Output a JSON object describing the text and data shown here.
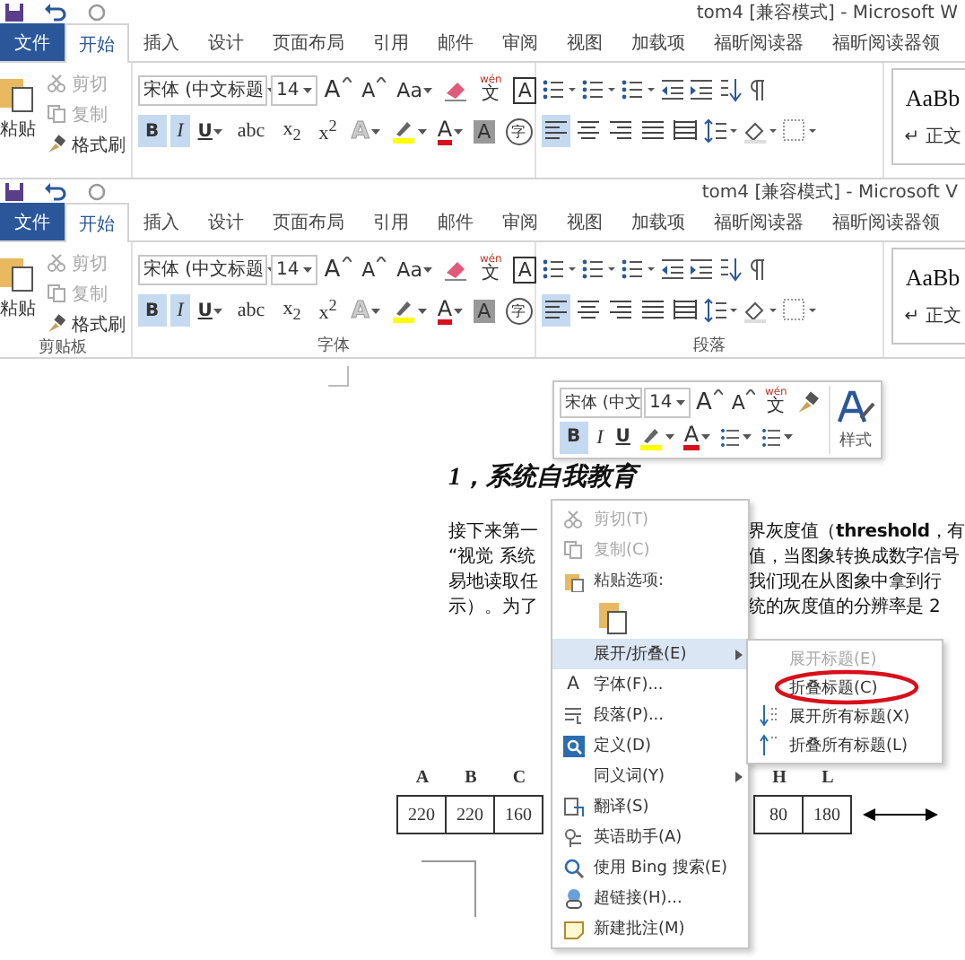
{
  "ribbons": [
    {
      "title": "tom4 [兼容模式] - Microsoft W",
      "tabs": [
        {
          "label": "文件",
          "kind": "file",
          "selected": false
        },
        {
          "label": "开始",
          "kind": "tab",
          "selected": true
        },
        {
          "label": "插入",
          "kind": "tab",
          "selected": false
        },
        {
          "label": "设计",
          "kind": "tab",
          "selected": false
        },
        {
          "label": "页面布局",
          "kind": "tab",
          "selected": false
        },
        {
          "label": "引用",
          "kind": "tab",
          "selected": false
        },
        {
          "label": "邮件",
          "kind": "tab",
          "selected": false
        },
        {
          "label": "审阅",
          "kind": "tab",
          "selected": false
        },
        {
          "label": "视图",
          "kind": "tab",
          "selected": false
        },
        {
          "label": "加载项",
          "kind": "tab",
          "selected": false
        },
        {
          "label": "福昕阅读器",
          "kind": "tab",
          "selected": false
        },
        {
          "label": "福昕阅读器领",
          "kind": "tab",
          "selected": false
        }
      ],
      "clipboard": {
        "paste": "粘贴",
        "small": [
          {
            "label": "剪切",
            "disabled": true
          },
          {
            "label": "复制",
            "disabled": true
          },
          {
            "label": "格式刷",
            "disabled": false
          }
        ]
      },
      "font": {
        "name": "宋体 (中文标题",
        "size": "14",
        "row1": [
          {
            "kind": "grow",
            "label": "A"
          },
          {
            "kind": "shrink",
            "label": "A"
          },
          {
            "kind": "case",
            "label": "Aa"
          },
          {
            "kind": "clear"
          },
          {
            "kind": "phonetic",
            "ruby": "wén",
            "label": "文"
          },
          {
            "kind": "border",
            "label": "A"
          }
        ],
        "row2": [
          {
            "kind": "toggle",
            "label": "B",
            "selected": true
          },
          {
            "kind": "toggle",
            "label": "I",
            "selected": true
          },
          {
            "kind": "underline",
            "label": "U",
            "selected": false
          },
          {
            "kind": "toggle",
            "label": "abc",
            "selected": false
          },
          {
            "kind": "toggle",
            "label": "x$_{2}$",
            "selected": false
          },
          {
            "kind": "toggle",
            "label": "x$^{2}$",
            "selected": false
          },
          {
            "kind": "effects",
            "label": "A"
          },
          {
            "kind": "highlight"
          },
          {
            "kind": "color",
            "label": "A"
          },
          {
            "kind": "shade",
            "label": "A"
          },
          {
            "kind": "enclose",
            "label": "字"
          }
        ]
      },
      "paragraph": {
        "align_buttons": [
          {
            "selected": true
          },
          {
            "selected": false
          },
          {
            "selected": false
          },
          {
            "selected": false
          },
          {
            "selected": false
          }
        ]
      },
      "styles": {
        "preview": "AaBb",
        "name": "↵ 正文"
      }
    },
    {
      "title": "tom4 [兼容模式] - Microsoft V",
      "tabs": [
        {
          "label": "文件",
          "kind": "file",
          "selected": false
        },
        {
          "label": "开始",
          "kind": "tab",
          "selected": true
        },
        {
          "label": "插入",
          "kind": "tab",
          "selected": false
        },
        {
          "label": "设计",
          "kind": "tab",
          "selected": false
        },
        {
          "label": "页面布局",
          "kind": "tab",
          "selected": false
        },
        {
          "label": "引用",
          "kind": "tab",
          "selected": false
        },
        {
          "label": "邮件",
          "kind": "tab",
          "selected": false
        },
        {
          "label": "审阅",
          "kind": "tab",
          "selected": false
        },
        {
          "label": "视图",
          "kind": "tab",
          "selected": false
        },
        {
          "label": "加载项",
          "kind": "tab",
          "selected": false
        },
        {
          "label": "福昕阅读器",
          "kind": "tab",
          "selected": false
        },
        {
          "label": "福昕阅读器领",
          "kind": "tab",
          "selected": false
        }
      ],
      "clipboard": {
        "paste": "粘贴",
        "small": [
          {
            "label": "剪切",
            "disabled": true
          },
          {
            "label": "复制",
            "disabled": true
          },
          {
            "label": "格式刷",
            "disabled": false
          }
        ]
      },
      "font": {
        "name": "宋体 (中文标题",
        "size": "14",
        "row1": [
          {
            "kind": "grow",
            "label": "A"
          },
          {
            "kind": "shrink",
            "label": "A"
          },
          {
            "kind": "case",
            "label": "Aa"
          },
          {
            "kind": "clear"
          },
          {
            "kind": "phonetic",
            "ruby": "wén",
            "label": "文"
          },
          {
            "kind": "border",
            "label": "A"
          }
        ],
        "row2": [
          {
            "kind": "toggle",
            "label": "B",
            "selected": true
          },
          {
            "kind": "toggle",
            "label": "I",
            "selected": true
          },
          {
            "kind": "underline",
            "label": "U",
            "selected": false
          },
          {
            "kind": "toggle",
            "label": "abc",
            "selected": false
          },
          {
            "kind": "toggle",
            "label": "x$_{2}$",
            "selected": false
          },
          {
            "kind": "toggle",
            "label": "x$^{2}$",
            "selected": false
          },
          {
            "kind": "effects",
            "label": "A"
          },
          {
            "kind": "highlight"
          },
          {
            "kind": "color",
            "label": "A"
          },
          {
            "kind": "shade",
            "label": "A"
          },
          {
            "kind": "enclose",
            "label": "字"
          }
        ]
      },
      "paragraph": {
        "align_buttons": [
          {
            "selected": true
          },
          {
            "selected": false
          },
          {
            "selected": false
          },
          {
            "selected": false
          },
          {
            "selected": false
          }
        ]
      },
      "styles": {
        "preview": "AaBb",
        "name": "↵ 正文"
      },
      "group_labels": [
        "剪贴板",
        "字体",
        "段落"
      ]
    }
  ],
  "document": {
    "heading": "1，系统自我教育",
    "paragraph_left": [
      "接下来第一",
      "“视觉 系统",
      "易地读取任",
      "示）。为了"
    ],
    "paragraph_right": [
      "界灰度值（**threshold**，有",
      "值，当图象转换成数字信号",
      "我们现在从图象中拿到行",
      "统的灰度值的分辨率是 2"
    ],
    "diagram_left": [
      {
        "label": "A",
        "value": "220"
      },
      {
        "label": "B",
        "value": "220"
      },
      {
        "label": "C",
        "value": "160"
      }
    ],
    "diagram_right": [
      {
        "label": "H",
        "value": "80"
      },
      {
        "label": "L",
        "value": "180"
      }
    ]
  },
  "mini_toolbar": {
    "font": "宋体 (中文",
    "size": "14",
    "styles": "样式",
    "row1": [
      {
        "kind": "grow",
        "label": "A"
      },
      {
        "kind": "shrink",
        "label": "A"
      },
      {
        "kind": "phonetic",
        "ruby": "wén",
        "label": "文"
      },
      {
        "kind": "painter"
      }
    ],
    "row2": [
      {
        "kind": "toggle",
        "label": "B",
        "selected": true
      },
      {
        "kind": "toggle",
        "label": "I",
        "selected": false
      },
      {
        "kind": "underline",
        "label": "U",
        "selected": false
      },
      {
        "kind": "highlight"
      },
      {
        "kind": "color",
        "label": "A"
      },
      {
        "kind": "bullets"
      },
      {
        "kind": "numbering"
      }
    ]
  },
  "context_menu": {
    "items": [
      {
        "kind": "item",
        "label": "剪切(T)",
        "disabled": true,
        "selected": false,
        "submenu": false
      },
      {
        "kind": "item",
        "label": "复制(C)",
        "disabled": true,
        "selected": false,
        "submenu": false
      },
      {
        "kind": "header",
        "label": "粘贴选项:"
      },
      {
        "kind": "paste_option"
      },
      {
        "kind": "item",
        "label": "展开/折叠(E)",
        "disabled": false,
        "selected": true,
        "submenu": true
      },
      {
        "kind": "item",
        "label": "字体(F)...",
        "glyph": "A",
        "disabled": false,
        "selected": false,
        "submenu": false
      },
      {
        "kind": "item",
        "label": "段落(P)...",
        "disabled": false,
        "selected": false,
        "submenu": false
      },
      {
        "kind": "item",
        "label": "定义(D)",
        "disabled": false,
        "selected": false,
        "submenu": false
      },
      {
        "kind": "item",
        "label": "同义词(Y)",
        "disabled": false,
        "selected": false,
        "submenu": true
      },
      {
        "kind": "item",
        "label": "翻译(S)",
        "disabled": false,
        "selected": false,
        "submenu": false
      },
      {
        "kind": "item",
        "label": "英语助手(A)",
        "disabled": false,
        "selected": false,
        "submenu": false
      },
      {
        "kind": "item",
        "label": "使用 Bing 搜索(E)",
        "disabled": false,
        "selected": false,
        "submenu": false
      },
      {
        "kind": "item",
        "label": "超链接(H)...",
        "disabled": false,
        "selected": false,
        "submenu": false
      },
      {
        "kind": "item",
        "label": "新建批注(M)",
        "disabled": false,
        "selected": false,
        "submenu": false
      }
    ]
  },
  "submenu": {
    "items": [
      {
        "label": "展开标题(E)",
        "disabled": true,
        "circled": false
      },
      {
        "label": "折叠标题(C)",
        "disabled": false,
        "circled": true
      },
      {
        "label": "展开所有标题(X)",
        "disabled": false,
        "circled": false
      },
      {
        "label": "折叠所有标题(L)",
        "disabled": false,
        "circled": false
      }
    ]
  }
}
